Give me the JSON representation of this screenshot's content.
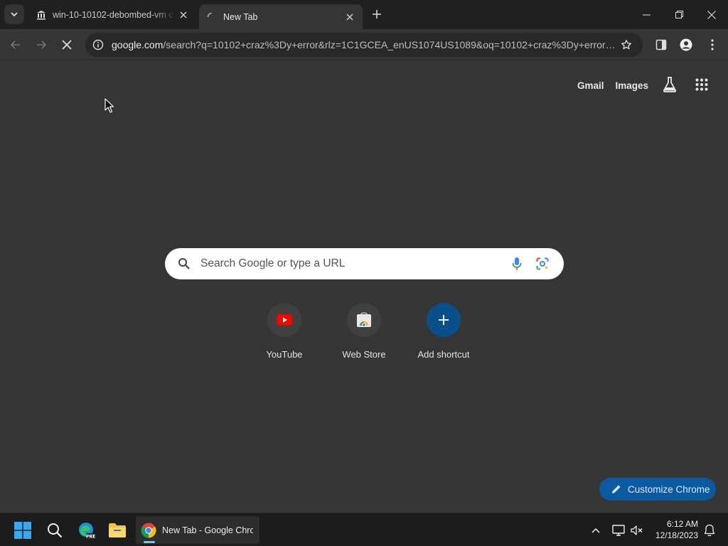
{
  "tabs": [
    {
      "title": "win-10-10102-debombed-vm c",
      "icon": "bank-icon",
      "active": false
    },
    {
      "title": "New Tab",
      "icon": "loading-spinner-icon",
      "active": true
    }
  ],
  "toolbar": {
    "url_host": "google.com",
    "url_rest": "/search?q=10102+craz%3Dy+error&rlz=1C1GCEA_enUS1074US1089&oq=10102+craz%3Dy+error&..."
  },
  "top_links": {
    "gmail": "Gmail",
    "images": "Images"
  },
  "search": {
    "placeholder": "Search Google or type a URL"
  },
  "shortcuts": [
    {
      "label": "YouTube",
      "icon": "youtube-icon"
    },
    {
      "label": "Web Store",
      "icon": "web-store-icon"
    },
    {
      "label": "Add shortcut",
      "icon": "plus-icon"
    }
  ],
  "customize": {
    "label": "Customize Chrome"
  },
  "taskbar": {
    "chrome_title": "New Tab - Google Chrome",
    "time": "6:12 AM",
    "date": "12/18/2023"
  },
  "colors": {
    "page_bg": "#353535",
    "tabstrip_bg": "#202020",
    "accent": "#0b5aa0",
    "taskbar_bg": "#1c1c1c"
  }
}
